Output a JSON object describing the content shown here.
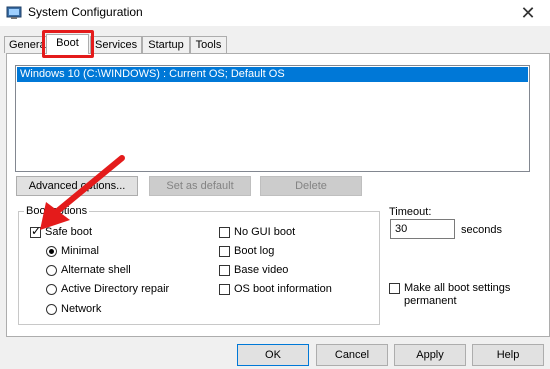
{
  "window": {
    "title": "System Configuration",
    "close_glyph": "✕",
    "icon": "msconfig-icon"
  },
  "tabs": [
    {
      "label": "General",
      "active": false
    },
    {
      "label": "Boot",
      "active": true
    },
    {
      "label": "Services",
      "active": false
    },
    {
      "label": "Startup",
      "active": false
    },
    {
      "label": "Tools",
      "active": false
    }
  ],
  "os_list": {
    "items": [
      "Windows 10 (C:\\WINDOWS) : Current OS; Default OS"
    ],
    "selected_index": 0
  },
  "list_buttons": {
    "advanced": "Advanced options...",
    "set_default": "Set as default",
    "delete": "Delete"
  },
  "boot_options": {
    "legend": "Boot options",
    "safe_boot": {
      "label": "Safe boot",
      "checked": true
    },
    "radios": [
      {
        "label": "Minimal",
        "selected": true
      },
      {
        "label": "Alternate shell",
        "selected": false
      },
      {
        "label": "Active Directory repair",
        "selected": false
      },
      {
        "label": "Network",
        "selected": false
      }
    ],
    "right_checks": [
      {
        "label": "No GUI boot",
        "checked": false
      },
      {
        "label": "Boot log",
        "checked": false
      },
      {
        "label": "Base video",
        "checked": false
      },
      {
        "label": "OS boot information",
        "checked": false
      }
    ]
  },
  "timeout": {
    "label": "Timeout:",
    "value": "30",
    "unit": "seconds"
  },
  "make_permanent": {
    "label_line1": "Make all boot settings",
    "label_line2": "permanent",
    "checked": false
  },
  "footer_buttons": {
    "ok": "OK",
    "cancel": "Cancel",
    "apply": "Apply",
    "help": "Help"
  },
  "annotation_color": "#e41b1b",
  "selection_color": "#0078d7"
}
